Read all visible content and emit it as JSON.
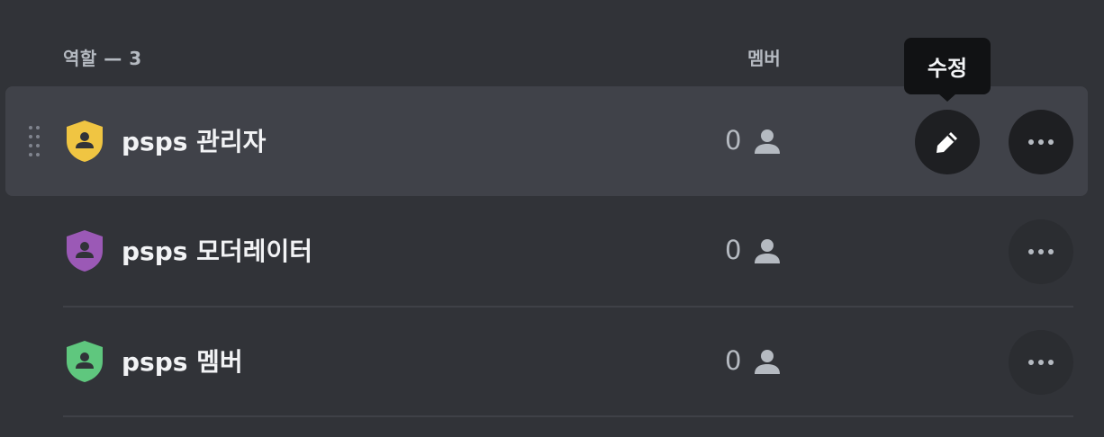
{
  "header": {
    "roles_label": "역할 — 3",
    "members_label": "멤버"
  },
  "tooltip": {
    "label": "수정"
  },
  "roles": [
    {
      "name": "psps 관리자",
      "member_count": "0",
      "color": "#f0c542",
      "hovered": true
    },
    {
      "name": "psps 모더레이터",
      "member_count": "0",
      "color": "#9b59b6"
    },
    {
      "name": "psps 멤버",
      "member_count": "0",
      "color": "#5fc77e"
    }
  ],
  "icons": {
    "drag": "drag-handle-icon",
    "role": "shield-user-icon",
    "member": "person-icon",
    "edit": "pencil-icon",
    "more": "more-horizontal-icon"
  }
}
